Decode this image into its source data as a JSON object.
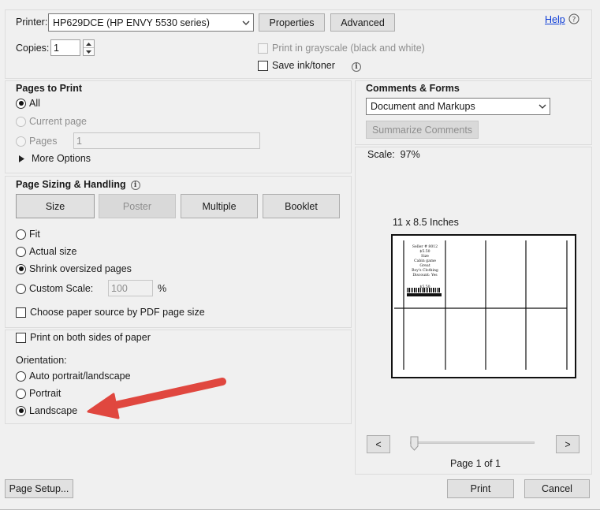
{
  "printer": {
    "label": "Printer:",
    "selected": "HP629DCE (HP ENVY 5530 series)",
    "properties_label": "Properties",
    "advanced_label": "Advanced",
    "help_label": "Help"
  },
  "copies": {
    "label": "Copies:",
    "value": "1"
  },
  "print_options": {
    "grayscale_label": "Print in grayscale (black and white)",
    "save_ink_label": "Save ink/toner"
  },
  "pages_to_print": {
    "title": "Pages to Print",
    "all_label": "All",
    "current_page_label": "Current page",
    "pages_label": "Pages",
    "pages_value": "1",
    "more_options_label": "More Options"
  },
  "page_sizing": {
    "title": "Page Sizing & Handling",
    "tabs": [
      "Size",
      "Poster",
      "Multiple",
      "Booklet"
    ],
    "fit_label": "Fit",
    "actual_size_label": "Actual size",
    "shrink_label": "Shrink oversized pages",
    "custom_scale_label": "Custom Scale:",
    "custom_scale_value": "100",
    "percent_label": "%",
    "paper_source_label": "Choose paper source by PDF page size"
  },
  "duplex": {
    "both_sides_label": "Print on both sides of paper"
  },
  "orientation": {
    "title": "Orientation:",
    "auto_label": "Auto portrait/landscape",
    "portrait_label": "Portrait",
    "landscape_label": "Landscape"
  },
  "comments_forms": {
    "title": "Comments & Forms",
    "selected": "Document and Markups",
    "summarize_label": "Summarize Comments"
  },
  "preview": {
    "scale_text": "Scale:  97%",
    "paper_size": "11 x 8.5 Inches",
    "page_info": "Page 1 of 1",
    "prev_label": "<",
    "next_label": ">",
    "label_content": {
      "line1": "Seller # 8012",
      "line2": "$5.50",
      "line3": "Size",
      "line4": "Cabin game",
      "line5": "Great",
      "line6": "Boy's Clothing",
      "line7": "Discount: Yes",
      "line8": "$5.50"
    }
  },
  "footer": {
    "page_setup_label": "Page Setup...",
    "print_label": "Print",
    "cancel_label": "Cancel"
  },
  "colors": {
    "dialog_bg": "#f0f0f0",
    "arrow": "#e0473f",
    "link": "#0b3bd6"
  }
}
